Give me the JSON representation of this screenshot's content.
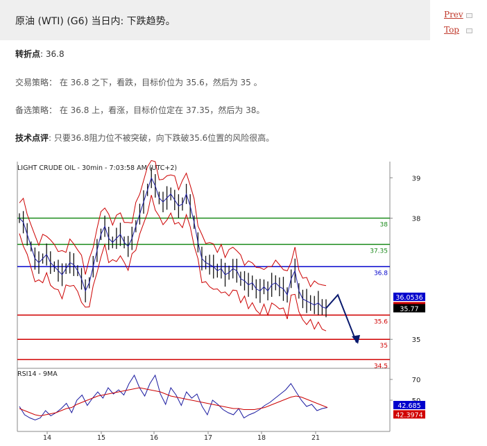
{
  "header": {
    "title": "原油 (WTI) (G6) 当日内: 下跌趋势。"
  },
  "nav": {
    "prev": "Prev",
    "top": "Top"
  },
  "pivot": {
    "label": "转折点",
    "value": ": 36.8"
  },
  "strategy": {
    "label": "交易策略",
    "text": "： 在 36.8 之下，看跌，目标价位为 35.6，然后为 35 。"
  },
  "alternative": {
    "label": "备选策略",
    "text": "： 在 36.8 上，看涨，目标价位定在 37.35，然后为 38。"
  },
  "comment": {
    "label": "技术点评",
    "text": ": 只要36.8阻力位不被突破，向下跌破35.6位置的风险很高。"
  },
  "chart_data": [
    {
      "type": "line",
      "title": "LIGHT CRUDE OIL - 30min - 7:03:58 AM (UTC+2)",
      "ylim": [
        34.3,
        39.4
      ],
      "x_ticks": [
        "14",
        "15",
        "16",
        "17",
        "18",
        "21"
      ],
      "y_ticks": [
        39,
        38,
        35
      ],
      "levels": [
        {
          "value": 38,
          "label": "38",
          "color": "#1a8a1a"
        },
        {
          "value": 37.35,
          "label": "37.35",
          "color": "#1a8a1a"
        },
        {
          "value": 36.8,
          "label": "36.8",
          "color": "#0000cc"
        },
        {
          "value": 35.6,
          "label": "35.6",
          "color": "#d00000"
        },
        {
          "value": 35,
          "label": "35",
          "color": "#d00000"
        },
        {
          "value": 34.5,
          "label": "34.5",
          "color": "#d00000"
        }
      ],
      "price_tags": [
        {
          "label": "36.0536",
          "value": 36.0536,
          "color": "#0000cc"
        },
        {
          "label": "35.821",
          "value": 35.821,
          "color": "#d00000"
        },
        {
          "label": "35.77",
          "value": 35.77,
          "color": "#000000"
        }
      ],
      "series": [
        {
          "values": [
            38.0,
            37.9,
            37.6,
            37.3,
            37.0,
            36.9,
            37.0,
            37.1,
            36.9,
            36.8,
            36.7,
            36.6,
            36.75,
            36.9,
            36.85,
            36.7,
            36.5,
            36.2,
            36.4,
            36.8,
            37.2,
            37.6,
            37.8,
            37.5,
            37.4,
            37.5,
            37.6,
            37.4,
            37.3,
            37.5,
            37.8,
            38.1,
            38.4,
            38.7,
            39.0,
            38.8,
            38.5,
            38.4,
            38.5,
            38.6,
            38.45,
            38.3,
            38.35,
            38.6,
            38.3,
            37.9,
            37.4,
            37.0,
            36.9,
            36.85,
            36.8,
            36.7,
            36.75,
            36.6,
            36.65,
            36.75,
            36.7,
            36.5,
            36.45,
            36.35,
            36.4,
            36.25,
            36.2,
            36.3,
            36.2,
            36.35,
            36.4,
            36.3,
            36.25,
            36.1,
            36.5,
            36.7,
            36.2,
            36.0,
            35.95,
            35.9,
            35.85,
            35.9,
            35.8,
            35.77
          ]
        }
      ]
    },
    {
      "type": "line",
      "title": "RSI14 - 9MA",
      "ylim": [
        20,
        80
      ],
      "y_ticks": [
        70,
        50
      ],
      "price_tags": [
        {
          "label": "42.685",
          "value": 42.685,
          "color": "#0000cc"
        },
        {
          "label": "42.3974",
          "value": 42.3974,
          "color": "#d00000"
        }
      ],
      "series": [
        {
          "values": [
            44,
            36,
            33,
            31,
            33,
            40,
            35,
            38,
            42,
            47,
            38,
            50,
            55,
            45,
            52,
            58,
            52,
            62,
            56,
            60,
            55,
            66,
            74,
            62,
            54,
            66,
            74,
            56,
            46,
            62,
            55,
            45,
            58,
            52,
            56,
            44,
            36,
            50,
            46,
            41,
            38,
            36,
            42,
            33,
            36,
            38,
            41,
            45,
            48,
            52,
            56,
            60,
            66,
            58,
            50,
            44,
            46,
            40,
            42,
            43
          ]
        },
        {
          "values": [
            42,
            40,
            38,
            36,
            35,
            36,
            37,
            38,
            40,
            42,
            43,
            46,
            48,
            50,
            52,
            54,
            55,
            56,
            57,
            58,
            59,
            60,
            61,
            62,
            61,
            60,
            59,
            58,
            56,
            54,
            53,
            52,
            51,
            50,
            49,
            48,
            47,
            46,
            45,
            44,
            43,
            42,
            42,
            41,
            41,
            41,
            42,
            43,
            45,
            47,
            49,
            51,
            53,
            54,
            53,
            51,
            49,
            47,
            45,
            43
          ]
        }
      ]
    }
  ]
}
